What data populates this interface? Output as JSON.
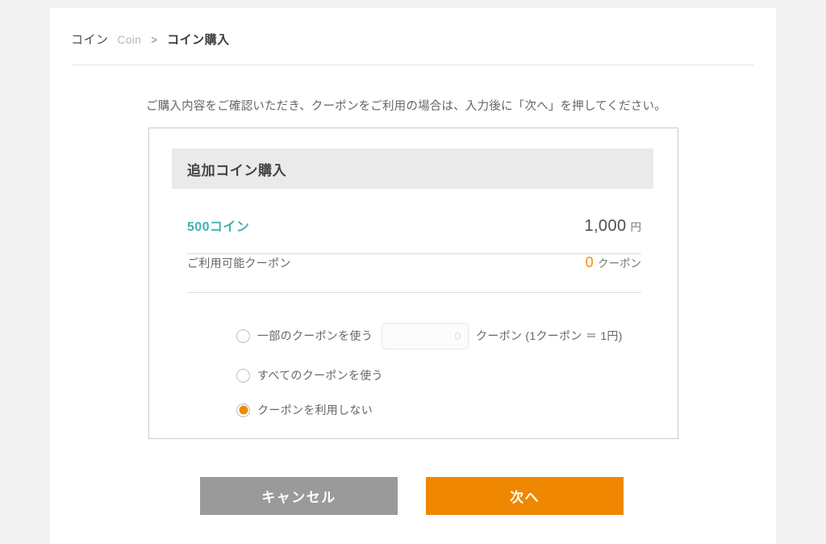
{
  "breadcrumb": {
    "root_ja": "コイン",
    "root_en": "Coin",
    "separator": ">",
    "current": "コイン購入"
  },
  "instruction": "ご購入内容をご確認いただき、クーポンをご利用の場合は、入力後に「次へ」を押してください。",
  "card": {
    "header_title": "追加コイン購入",
    "rows": [
      {
        "label": "500コイン",
        "value": "1,000",
        "unit": "円"
      },
      {
        "label": "ご利用可能クーポン",
        "value": "0",
        "unit": "クーポン"
      }
    ]
  },
  "options": {
    "partial": {
      "label": "一部のクーポンを使う",
      "input_value": "0",
      "input_placeholder": "0",
      "suffix": "クーポン (1クーポン ＝ 1円)"
    },
    "all": {
      "label": "すべてのクーポンを使う"
    },
    "none": {
      "label": "クーポンを利用しない"
    }
  },
  "actions": {
    "cancel_label": "キャンセル",
    "next_label": "次へ"
  },
  "colors": {
    "accent_orange": "#f08700",
    "coin_teal": "#3fb4ae",
    "coupon_orange": "#ef8b12",
    "cancel_gray": "#9a9a9a",
    "page_background": "#f2f2f2",
    "panel_background": "#ffffff",
    "card_header_background": "#eaeaea"
  }
}
